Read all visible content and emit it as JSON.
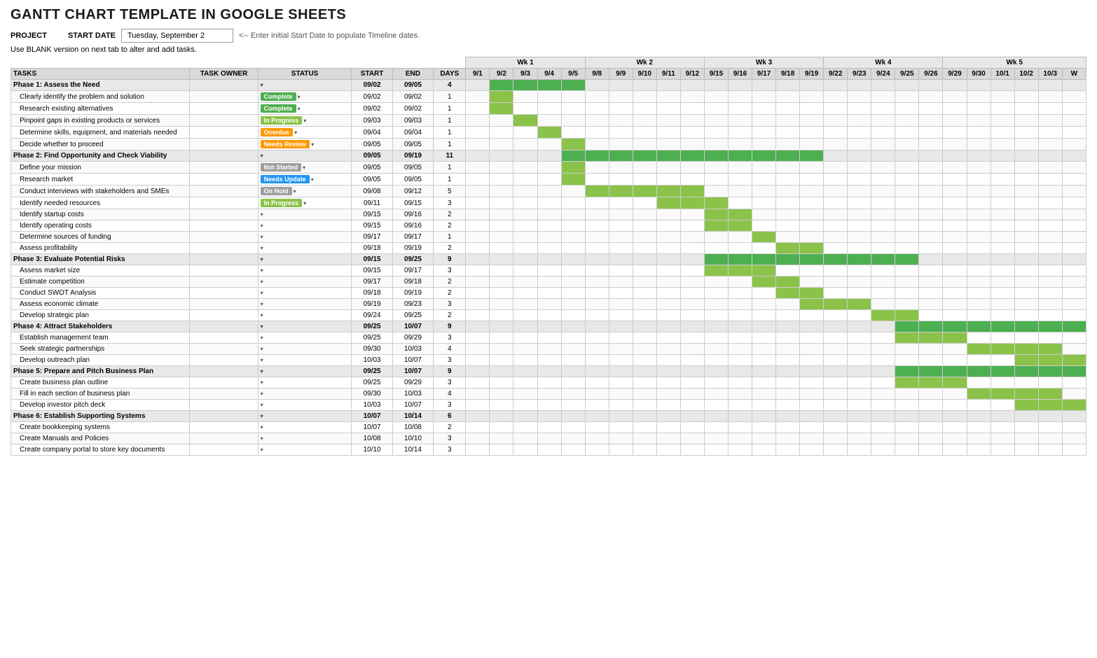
{
  "title": "GANTT CHART TEMPLATE IN GOOGLE SHEETS",
  "project_label": "PROJECT",
  "start_date_label": "START DATE",
  "start_date_value": "Tuesday, September 2",
  "hint_text": "<-- Enter initial Start Date to populate Timeline dates.",
  "blank_note": "Use BLANK version on next tab to alter and add tasks.",
  "col_headers": {
    "tasks": "TASKS",
    "task_owner": "TASK OWNER",
    "status": "STATUS",
    "start": "START",
    "end": "END",
    "days": "DAYS"
  },
  "weeks": [
    {
      "label": "Wk 1",
      "span": 5
    },
    {
      "label": "Wk 2",
      "span": 5
    },
    {
      "label": "Wk 3",
      "span": 5
    },
    {
      "label": "Wk 4",
      "span": 5
    },
    {
      "label": "Wk 5",
      "span": 5
    }
  ],
  "days": [
    "9/1",
    "9/2",
    "9/3",
    "9/4",
    "9/5",
    "9/8",
    "9/9",
    "9/10",
    "9/11",
    "9/12",
    "9/15",
    "9/16",
    "9/17",
    "9/18",
    "9/19",
    "9/22",
    "9/23",
    "9/24",
    "9/25",
    "9/26",
    "9/29",
    "9/30",
    "10/1",
    "10/2",
    "10/3",
    "W"
  ],
  "rows": [
    {
      "type": "phase",
      "name": "Phase 1: Assess the Need",
      "owner": "",
      "status": "",
      "status_type": "",
      "start": "09/02",
      "end": "09/05",
      "days": "4",
      "bars": [
        0,
        1,
        1,
        1,
        1,
        0,
        0,
        0,
        0,
        0,
        0,
        0,
        0,
        0,
        0,
        0,
        0,
        0,
        0,
        0,
        0,
        0,
        0,
        0,
        0,
        0
      ]
    },
    {
      "type": "task",
      "name": "Clearly identify the problem and solution",
      "owner": "",
      "status": "Complete",
      "status_type": "complete",
      "start": "09/02",
      "end": "09/02",
      "days": "1",
      "bars": [
        0,
        1,
        0,
        0,
        0,
        0,
        0,
        0,
        0,
        0,
        0,
        0,
        0,
        0,
        0,
        0,
        0,
        0,
        0,
        0,
        0,
        0,
        0,
        0,
        0,
        0
      ]
    },
    {
      "type": "task",
      "name": "Research existing alternatives",
      "owner": "",
      "status": "Complete",
      "status_type": "complete",
      "start": "09/02",
      "end": "09/02",
      "days": "1",
      "bars": [
        0,
        1,
        0,
        0,
        0,
        0,
        0,
        0,
        0,
        0,
        0,
        0,
        0,
        0,
        0,
        0,
        0,
        0,
        0,
        0,
        0,
        0,
        0,
        0,
        0,
        0
      ]
    },
    {
      "type": "task",
      "name": "Pinpoint gaps in existing products or services",
      "owner": "",
      "status": "In Progress",
      "status_type": "inprogress",
      "start": "09/03",
      "end": "09/03",
      "days": "1",
      "bars": [
        0,
        0,
        1,
        0,
        0,
        0,
        0,
        0,
        0,
        0,
        0,
        0,
        0,
        0,
        0,
        0,
        0,
        0,
        0,
        0,
        0,
        0,
        0,
        0,
        0,
        0
      ]
    },
    {
      "type": "task",
      "name": "Determine skills, equipment, and materials needed",
      "owner": "",
      "status": "Overdue",
      "status_type": "overdue",
      "start": "09/04",
      "end": "09/04",
      "days": "1",
      "bars": [
        0,
        0,
        0,
        1,
        0,
        0,
        0,
        0,
        0,
        0,
        0,
        0,
        0,
        0,
        0,
        0,
        0,
        0,
        0,
        0,
        0,
        0,
        0,
        0,
        0,
        0
      ]
    },
    {
      "type": "task",
      "name": "Decide whether to proceed",
      "owner": "",
      "status": "Needs Review",
      "status_type": "needsreview",
      "start": "09/05",
      "end": "09/05",
      "days": "1",
      "bars": [
        0,
        0,
        0,
        0,
        1,
        0,
        0,
        0,
        0,
        0,
        0,
        0,
        0,
        0,
        0,
        0,
        0,
        0,
        0,
        0,
        0,
        0,
        0,
        0,
        0,
        0
      ]
    },
    {
      "type": "phase",
      "name": "Phase 2: Find Opportunity and Check Viability",
      "owner": "",
      "status": "",
      "status_type": "",
      "start": "09/05",
      "end": "09/19",
      "days": "11",
      "bars": [
        0,
        0,
        0,
        0,
        1,
        1,
        1,
        1,
        1,
        1,
        1,
        1,
        1,
        1,
        1,
        0,
        0,
        0,
        0,
        0,
        0,
        0,
        0,
        0,
        0,
        0
      ]
    },
    {
      "type": "task",
      "name": "Define your mission",
      "owner": "",
      "status": "Not Started",
      "status_type": "notstarted",
      "start": "09/05",
      "end": "09/05",
      "days": "1",
      "bars": [
        0,
        0,
        0,
        0,
        1,
        0,
        0,
        0,
        0,
        0,
        0,
        0,
        0,
        0,
        0,
        0,
        0,
        0,
        0,
        0,
        0,
        0,
        0,
        0,
        0,
        0
      ]
    },
    {
      "type": "task",
      "name": "Research market",
      "owner": "",
      "status": "Needs Update",
      "status_type": "needsupdate",
      "start": "09/05",
      "end": "09/05",
      "days": "1",
      "bars": [
        0,
        0,
        0,
        0,
        1,
        0,
        0,
        0,
        0,
        0,
        0,
        0,
        0,
        0,
        0,
        0,
        0,
        0,
        0,
        0,
        0,
        0,
        0,
        0,
        0,
        0
      ]
    },
    {
      "type": "task",
      "name": "Conduct interviews with stakeholders and SMEs",
      "owner": "",
      "status": "On Hold",
      "status_type": "onhold",
      "start": "09/08",
      "end": "09/12",
      "days": "5",
      "bars": [
        0,
        0,
        0,
        0,
        0,
        1,
        1,
        1,
        1,
        1,
        0,
        0,
        0,
        0,
        0,
        0,
        0,
        0,
        0,
        0,
        0,
        0,
        0,
        0,
        0,
        0
      ]
    },
    {
      "type": "task",
      "name": "Identify needed resources",
      "owner": "",
      "status": "In Progress",
      "status_type": "inprogress",
      "start": "09/11",
      "end": "09/15",
      "days": "3",
      "bars": [
        0,
        0,
        0,
        0,
        0,
        0,
        0,
        0,
        1,
        1,
        1,
        0,
        0,
        0,
        0,
        0,
        0,
        0,
        0,
        0,
        0,
        0,
        0,
        0,
        0,
        0
      ]
    },
    {
      "type": "task",
      "name": "Identify startup costs",
      "owner": "",
      "status": "",
      "status_type": "",
      "start": "09/15",
      "end": "09/16",
      "days": "2",
      "bars": [
        0,
        0,
        0,
        0,
        0,
        0,
        0,
        0,
        0,
        0,
        1,
        1,
        0,
        0,
        0,
        0,
        0,
        0,
        0,
        0,
        0,
        0,
        0,
        0,
        0,
        0
      ]
    },
    {
      "type": "task",
      "name": "Identify operating costs",
      "owner": "",
      "status": "",
      "status_type": "",
      "start": "09/15",
      "end": "09/16",
      "days": "2",
      "bars": [
        0,
        0,
        0,
        0,
        0,
        0,
        0,
        0,
        0,
        0,
        1,
        1,
        0,
        0,
        0,
        0,
        0,
        0,
        0,
        0,
        0,
        0,
        0,
        0,
        0,
        0
      ]
    },
    {
      "type": "task",
      "name": "Determine sources of funding",
      "owner": "",
      "status": "",
      "status_type": "",
      "start": "09/17",
      "end": "09/17",
      "days": "1",
      "bars": [
        0,
        0,
        0,
        0,
        0,
        0,
        0,
        0,
        0,
        0,
        0,
        0,
        1,
        0,
        0,
        0,
        0,
        0,
        0,
        0,
        0,
        0,
        0,
        0,
        0,
        0
      ]
    },
    {
      "type": "task",
      "name": "Assess profitability",
      "owner": "",
      "status": "",
      "status_type": "",
      "start": "09/18",
      "end": "09/19",
      "days": "2",
      "bars": [
        0,
        0,
        0,
        0,
        0,
        0,
        0,
        0,
        0,
        0,
        0,
        0,
        0,
        1,
        1,
        0,
        0,
        0,
        0,
        0,
        0,
        0,
        0,
        0,
        0,
        0
      ]
    },
    {
      "type": "phase",
      "name": "Phase 3: Evaluate Potential Risks",
      "owner": "",
      "status": "",
      "status_type": "",
      "start": "09/15",
      "end": "09/25",
      "days": "9",
      "bars": [
        0,
        0,
        0,
        0,
        0,
        0,
        0,
        0,
        0,
        0,
        1,
        1,
        1,
        1,
        1,
        1,
        1,
        1,
        1,
        0,
        0,
        0,
        0,
        0,
        0,
        0
      ]
    },
    {
      "type": "task",
      "name": "Assess market size",
      "owner": "",
      "status": "",
      "status_type": "",
      "start": "09/15",
      "end": "09/17",
      "days": "3",
      "bars": [
        0,
        0,
        0,
        0,
        0,
        0,
        0,
        0,
        0,
        0,
        1,
        1,
        1,
        0,
        0,
        0,
        0,
        0,
        0,
        0,
        0,
        0,
        0,
        0,
        0,
        0
      ]
    },
    {
      "type": "task",
      "name": "Estimate competition",
      "owner": "",
      "status": "",
      "status_type": "",
      "start": "09/17",
      "end": "09/18",
      "days": "2",
      "bars": [
        0,
        0,
        0,
        0,
        0,
        0,
        0,
        0,
        0,
        0,
        0,
        0,
        1,
        1,
        0,
        0,
        0,
        0,
        0,
        0,
        0,
        0,
        0,
        0,
        0,
        0
      ]
    },
    {
      "type": "task",
      "name": "Conduct SWOT Analysis",
      "owner": "",
      "status": "",
      "status_type": "",
      "start": "09/18",
      "end": "09/19",
      "days": "2",
      "bars": [
        0,
        0,
        0,
        0,
        0,
        0,
        0,
        0,
        0,
        0,
        0,
        0,
        0,
        1,
        1,
        0,
        0,
        0,
        0,
        0,
        0,
        0,
        0,
        0,
        0,
        0
      ]
    },
    {
      "type": "task",
      "name": "Assess economic climate",
      "owner": "",
      "status": "",
      "status_type": "",
      "start": "09/19",
      "end": "09/23",
      "days": "3",
      "bars": [
        0,
        0,
        0,
        0,
        0,
        0,
        0,
        0,
        0,
        0,
        0,
        0,
        0,
        0,
        1,
        1,
        1,
        0,
        0,
        0,
        0,
        0,
        0,
        0,
        0,
        0
      ]
    },
    {
      "type": "task",
      "name": "Develop strategic plan",
      "owner": "",
      "status": "",
      "status_type": "",
      "start": "09/24",
      "end": "09/25",
      "days": "2",
      "bars": [
        0,
        0,
        0,
        0,
        0,
        0,
        0,
        0,
        0,
        0,
        0,
        0,
        0,
        0,
        0,
        0,
        0,
        1,
        1,
        0,
        0,
        0,
        0,
        0,
        0,
        0
      ]
    },
    {
      "type": "phase",
      "name": "Phase 4: Attract Stakeholders",
      "owner": "",
      "status": "",
      "status_type": "",
      "start": "09/25",
      "end": "10/07",
      "days": "9",
      "bars": [
        0,
        0,
        0,
        0,
        0,
        0,
        0,
        0,
        0,
        0,
        0,
        0,
        0,
        0,
        0,
        0,
        0,
        0,
        1,
        1,
        1,
        1,
        1,
        1,
        1,
        1
      ]
    },
    {
      "type": "task",
      "name": "Establish management team",
      "owner": "",
      "status": "",
      "status_type": "",
      "start": "09/25",
      "end": "09/29",
      "days": "3",
      "bars": [
        0,
        0,
        0,
        0,
        0,
        0,
        0,
        0,
        0,
        0,
        0,
        0,
        0,
        0,
        0,
        0,
        0,
        0,
        1,
        1,
        1,
        0,
        0,
        0,
        0,
        0
      ]
    },
    {
      "type": "task",
      "name": "Seek strategic partnerships",
      "owner": "",
      "status": "",
      "status_type": "",
      "start": "09/30",
      "end": "10/03",
      "days": "4",
      "bars": [
        0,
        0,
        0,
        0,
        0,
        0,
        0,
        0,
        0,
        0,
        0,
        0,
        0,
        0,
        0,
        0,
        0,
        0,
        0,
        0,
        0,
        1,
        1,
        1,
        1,
        0
      ]
    },
    {
      "type": "task",
      "name": "Develop outreach plan",
      "owner": "",
      "status": "",
      "status_type": "",
      "start": "10/03",
      "end": "10/07",
      "days": "3",
      "bars": [
        0,
        0,
        0,
        0,
        0,
        0,
        0,
        0,
        0,
        0,
        0,
        0,
        0,
        0,
        0,
        0,
        0,
        0,
        0,
        0,
        0,
        0,
        0,
        1,
        1,
        1
      ]
    },
    {
      "type": "phase",
      "name": "Phase 5: Prepare and Pitch Business Plan",
      "owner": "",
      "status": "",
      "status_type": "",
      "start": "09/25",
      "end": "10/07",
      "days": "9",
      "bars": [
        0,
        0,
        0,
        0,
        0,
        0,
        0,
        0,
        0,
        0,
        0,
        0,
        0,
        0,
        0,
        0,
        0,
        0,
        1,
        1,
        1,
        1,
        1,
        1,
        1,
        1
      ]
    },
    {
      "type": "task",
      "name": "Create business plan outline",
      "owner": "",
      "status": "",
      "status_type": "",
      "start": "09/25",
      "end": "09/29",
      "days": "3",
      "bars": [
        0,
        0,
        0,
        0,
        0,
        0,
        0,
        0,
        0,
        0,
        0,
        0,
        0,
        0,
        0,
        0,
        0,
        0,
        1,
        1,
        1,
        0,
        0,
        0,
        0,
        0
      ]
    },
    {
      "type": "task",
      "name": "Fill in each section of business plan",
      "owner": "",
      "status": "",
      "status_type": "",
      "start": "09/30",
      "end": "10/03",
      "days": "4",
      "bars": [
        0,
        0,
        0,
        0,
        0,
        0,
        0,
        0,
        0,
        0,
        0,
        0,
        0,
        0,
        0,
        0,
        0,
        0,
        0,
        0,
        0,
        1,
        1,
        1,
        1,
        0
      ]
    },
    {
      "type": "task",
      "name": "Develop investor pitch deck",
      "owner": "",
      "status": "",
      "status_type": "",
      "start": "10/03",
      "end": "10/07",
      "days": "3",
      "bars": [
        0,
        0,
        0,
        0,
        0,
        0,
        0,
        0,
        0,
        0,
        0,
        0,
        0,
        0,
        0,
        0,
        0,
        0,
        0,
        0,
        0,
        0,
        0,
        1,
        1,
        1
      ]
    },
    {
      "type": "phase",
      "name": "Phase 6: Establish Supporting Systems",
      "owner": "",
      "status": "",
      "status_type": "",
      "start": "10/07",
      "end": "10/14",
      "days": "6",
      "bars": [
        0,
        0,
        0,
        0,
        0,
        0,
        0,
        0,
        0,
        0,
        0,
        0,
        0,
        0,
        0,
        0,
        0,
        0,
        0,
        0,
        0,
        0,
        0,
        0,
        0,
        0
      ]
    },
    {
      "type": "task",
      "name": "Create bookkeeping systems",
      "owner": "",
      "status": "",
      "status_type": "",
      "start": "10/07",
      "end": "10/08",
      "days": "2",
      "bars": [
        0,
        0,
        0,
        0,
        0,
        0,
        0,
        0,
        0,
        0,
        0,
        0,
        0,
        0,
        0,
        0,
        0,
        0,
        0,
        0,
        0,
        0,
        0,
        0,
        0,
        0
      ]
    },
    {
      "type": "task",
      "name": "Create Manuals and Policies",
      "owner": "",
      "status": "",
      "status_type": "",
      "start": "10/08",
      "end": "10/10",
      "days": "3",
      "bars": [
        0,
        0,
        0,
        0,
        0,
        0,
        0,
        0,
        0,
        0,
        0,
        0,
        0,
        0,
        0,
        0,
        0,
        0,
        0,
        0,
        0,
        0,
        0,
        0,
        0,
        0
      ]
    },
    {
      "type": "task",
      "name": "Create company portal to store key documents",
      "owner": "",
      "status": "",
      "status_type": "",
      "start": "10/10",
      "end": "10/14",
      "days": "3",
      "bars": [
        0,
        0,
        0,
        0,
        0,
        0,
        0,
        0,
        0,
        0,
        0,
        0,
        0,
        0,
        0,
        0,
        0,
        0,
        0,
        0,
        0,
        0,
        0,
        0,
        0,
        0
      ]
    }
  ],
  "status_labels": {
    "complete": "Complete",
    "inprogress": "In Progress",
    "overdue": "Overdue",
    "needsreview": "Needs Review",
    "notstarted": "Not Started",
    "needsupdate": "Needs Update",
    "onhold": "On Hold"
  }
}
